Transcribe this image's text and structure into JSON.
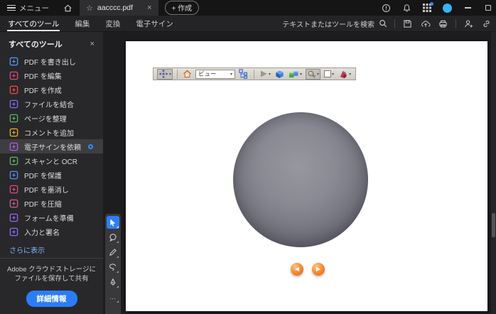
{
  "window": {
    "menu_label": "メニュー",
    "tab_title": "aacccc.pdf",
    "tab_star": "☆",
    "tab_close": "×",
    "create_label": "+ 作成"
  },
  "toolbar": {
    "tabs": [
      {
        "label": "すべてのツール",
        "active": true
      },
      {
        "label": "編集",
        "active": false
      },
      {
        "label": "変換",
        "active": false
      },
      {
        "label": "電子サイン",
        "active": false
      }
    ],
    "search_label": "テキストまたはツールを検索"
  },
  "sidebar": {
    "title": "すべてのツール",
    "close_label": "×",
    "items": [
      {
        "label": "PDF を書き出し",
        "icon": "export-pdf-icon",
        "color": "#4f9cf7"
      },
      {
        "label": "PDF を編集",
        "icon": "edit-pdf-icon",
        "color": "#e0487e"
      },
      {
        "label": "PDF を作成",
        "icon": "create-pdf-icon",
        "color": "#ef4c46"
      },
      {
        "label": "ファイルを結合",
        "icon": "combine-files-icon",
        "color": "#7f6bf6"
      },
      {
        "label": "ページを整理",
        "icon": "organize-pages-icon",
        "color": "#57b85e"
      },
      {
        "label": "コメントを追加",
        "icon": "add-comment-icon",
        "color": "#e5b41f"
      },
      {
        "label": "電子サインを依頼",
        "icon": "request-esign-icon",
        "color": "#b558e8",
        "active": true,
        "badge": true
      },
      {
        "label": "スキャンと OCR",
        "icon": "scan-ocr-icon",
        "color": "#5cb868"
      },
      {
        "label": "PDF を保護",
        "icon": "protect-pdf-icon",
        "color": "#5a8cf0"
      },
      {
        "label": "PDF を墨消し",
        "icon": "redact-pdf-icon",
        "color": "#dc4a86"
      },
      {
        "label": "PDF を圧縮",
        "icon": "compress-pdf-icon",
        "color": "#cf5d93"
      },
      {
        "label": "フォームを準備",
        "icon": "prepare-form-icon",
        "color": "#9a63f2"
      },
      {
        "label": "入力と署名",
        "icon": "fill-sign-icon",
        "color": "#8e6cf0"
      }
    ],
    "more_link": "さらに表示",
    "footer_line1": "Adobe クラウドストレージに",
    "footer_line2": "ファイルを保存して共有",
    "footer_button": "詳細情報"
  },
  "viewer": {
    "view_dropdown": "ビュー",
    "prev_arrow": "◀",
    "next_arrow": "▶",
    "more_tools": "…"
  },
  "colors": {
    "accent_blue": "#2d7ff9",
    "avatar_blue": "#35b5f5",
    "badge_blue": "#3b8bf4",
    "button_blue": "#2c7cf6",
    "link_blue": "#85b2f5",
    "nav_orange": "#f5913c"
  }
}
